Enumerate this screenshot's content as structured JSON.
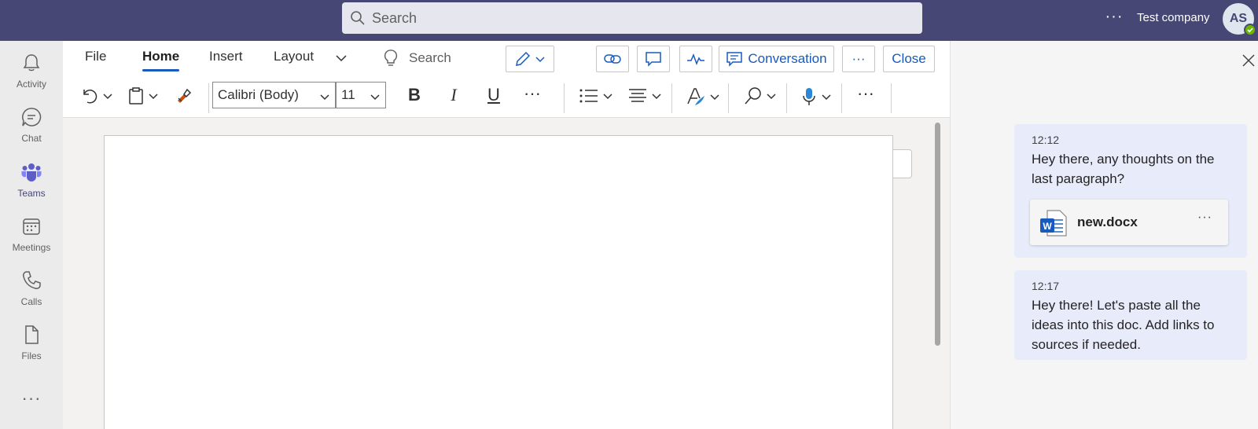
{
  "topbar": {
    "search_placeholder": "Search",
    "more": "···",
    "company": "Test company",
    "avatar_initials": "AS"
  },
  "rail": {
    "items": [
      {
        "label": "Activity",
        "icon": "bell-icon"
      },
      {
        "label": "Chat",
        "icon": "chat-icon"
      },
      {
        "label": "Teams",
        "icon": "teams-icon"
      },
      {
        "label": "Meetings",
        "icon": "calendar-icon"
      },
      {
        "label": "Calls",
        "icon": "phone-icon"
      },
      {
        "label": "Files",
        "icon": "file-icon"
      }
    ],
    "more": "···"
  },
  "word": {
    "tabs": [
      {
        "label": "File"
      },
      {
        "label": "Home"
      },
      {
        "label": "Insert"
      },
      {
        "label": "Layout"
      }
    ],
    "search_label": "Search",
    "conversation_label": "Conversation",
    "more_label": "···",
    "close_label": "Close",
    "font_name": "Calibri (Body)",
    "font_size": "11",
    "bold": "B",
    "italic": "I",
    "underline": "U",
    "ribbon_more": "···",
    "ribbon_more_2": "···"
  },
  "chat": {
    "messages": [
      {
        "time": "12:12",
        "text": "Hey there, any thoughts on the last paragraph?",
        "attachment": {
          "name": "new.docx",
          "more": "···"
        }
      },
      {
        "time": "12:17",
        "text": "Hey there! Let's paste all the ideas into this doc. Add links to sources if needed."
      }
    ]
  },
  "colors": {
    "topbar": "#464775",
    "accent": "#185abd",
    "bubble": "#e8ebfa",
    "presence": "#6bb700"
  }
}
